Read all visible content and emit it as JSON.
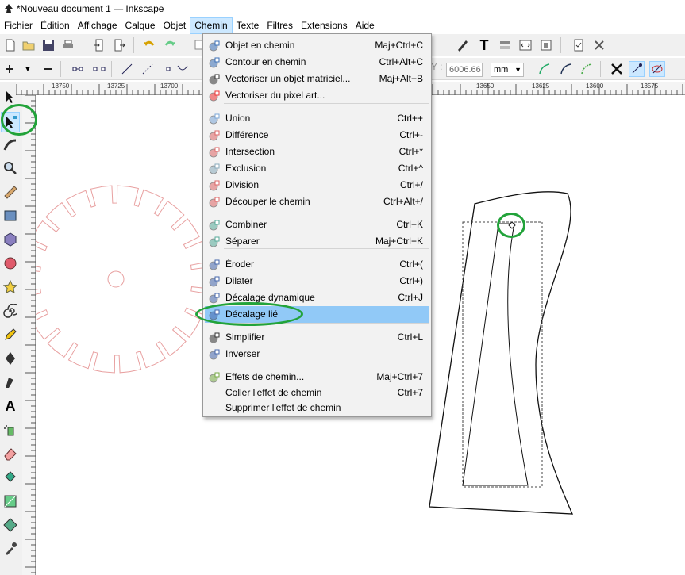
{
  "window": {
    "title": "*Nouveau document 1 — Inkscape"
  },
  "menubar": [
    {
      "label": "Fichier"
    },
    {
      "label": "Édition"
    },
    {
      "label": "Affichage"
    },
    {
      "label": "Calque"
    },
    {
      "label": "Objet"
    },
    {
      "label": "Chemin",
      "active": true
    },
    {
      "label": "Texte"
    },
    {
      "label": "Filtres"
    },
    {
      "label": "Extensions"
    },
    {
      "label": "Aide"
    }
  ],
  "toolbar2": {
    "y_label": "Y :",
    "y_value": "6006.66",
    "unit": "mm"
  },
  "ruler": {
    "labels": [
      "13750",
      "13725",
      "13700",
      "13650",
      "13625",
      "13600",
      "13575"
    ]
  },
  "dropdown": {
    "items": [
      {
        "icon": "object-to-path-icon",
        "label": "Objet en chemin",
        "shortcut": "Maj+Ctrl+C"
      },
      {
        "icon": "stroke-to-path-icon",
        "label": "Contour en chemin",
        "shortcut": "Ctrl+Alt+C"
      },
      {
        "icon": "trace-bitmap-icon",
        "label": "Vectoriser un objet matriciel...",
        "shortcut": "Maj+Alt+B"
      },
      {
        "icon": "trace-pixel-art-icon",
        "label": "Vectoriser du pixel art...",
        "shortcut": ""
      },
      {
        "icon": "union-icon",
        "label": "Union",
        "shortcut": "Ctrl++"
      },
      {
        "icon": "difference-icon",
        "label": "Différence",
        "shortcut": "Ctrl+-"
      },
      {
        "icon": "intersection-icon",
        "label": "Intersection",
        "shortcut": "Ctrl+*"
      },
      {
        "icon": "exclusion-icon",
        "label": "Exclusion",
        "shortcut": "Ctrl+^"
      },
      {
        "icon": "division-icon",
        "label": "Division",
        "shortcut": "Ctrl+/"
      },
      {
        "icon": "cut-path-icon",
        "label": "Découper le chemin",
        "shortcut": "Ctrl+Alt+/"
      },
      {
        "icon": "combine-icon",
        "label": "Combiner",
        "shortcut": "Ctrl+K"
      },
      {
        "icon": "break-apart-icon",
        "label": "Séparer",
        "shortcut": "Maj+Ctrl+K"
      },
      {
        "icon": "inset-icon",
        "label": "Éroder",
        "shortcut": "Ctrl+("
      },
      {
        "icon": "outset-icon",
        "label": "Dilater",
        "shortcut": "Ctrl+)"
      },
      {
        "icon": "dynamic-offset-icon",
        "label": "Décalage dynamique",
        "shortcut": "Ctrl+J"
      },
      {
        "icon": "linked-offset-icon",
        "label": "Décalage lié",
        "shortcut": "",
        "highlighted": true
      },
      {
        "icon": "simplify-icon",
        "label": "Simplifier",
        "shortcut": "Ctrl+L"
      },
      {
        "icon": "reverse-icon",
        "label": "Inverser",
        "shortcut": ""
      },
      {
        "icon": "path-effects-icon",
        "label": "Effets de chemin...",
        "shortcut": "Maj+Ctrl+7"
      },
      {
        "icon": "",
        "label": "Coller l'effet de chemin",
        "shortcut": "Ctrl+7"
      },
      {
        "icon": "",
        "label": "Supprimer l'effet de chemin",
        "shortcut": ""
      }
    ]
  },
  "colors": {
    "accent_green": "#22a33a",
    "highlight": "#91c9f7",
    "gear": "#e8a0a0"
  }
}
